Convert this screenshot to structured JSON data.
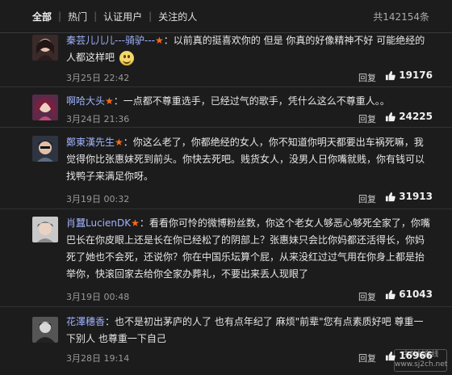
{
  "filters": {
    "tabs": [
      "全部",
      "热门",
      "认证用户",
      "关注的人"
    ],
    "total": "共142154条"
  },
  "comments": [
    {
      "user": "秦芸儿儿儿---骑驴---",
      "text": "：以前真的挺喜欢你的 但是 你真的好像精神不好  可能绝经的人都这样吧",
      "time": "3月25日 22:42",
      "reply": "回复",
      "likes": "19176"
    },
    {
      "user": "啊哈大头",
      "text": "：一点都不尊重选手，已经过气的歌手，凭什么这么不尊重人。。",
      "time": "3月24日 21:36",
      "reply": "回复",
      "likes": "24225"
    },
    {
      "user": "鄭東漢先生",
      "text": "：你这么老了，你都绝经的女人，你不知道你明天都要出车祸死嘛，我觉得你比张惠妹死到前头。你快去死吧。贱货女人，没男人日你嘴就贱，你有钱可以找鸭子来满足你呀。",
      "time": "3月19日 00:32",
      "reply": "回复",
      "likes": "31913"
    },
    {
      "user": "肖蠶LucienDK",
      "text": "：看看你可怜的微博粉丝数，你这个老女人够恶心够死全家了，你嘴巴长在你皮眼上还是长在你已经松了的阴部上？张惠妹只会比你妈都还活得长，你妈死了她也不会死，还说你？你在中国乐坛算个屁，从来没红过过气用在你身上都是抬举你，快滚回家去给你全家办葬礼，不要出来丢人现眼了",
      "time": "3月19日 00:48",
      "reply": "回复",
      "likes": "61043"
    },
    {
      "user": "花澤穗香",
      "text": "：也不是初出茅庐的人了 也有点年纪了 麻烦\"前辈\"您有点素质好吧 尊重一下别人 也尊重一下自己",
      "time": "3月28日 19:14",
      "reply": "回复",
      "likes": "16966"
    }
  ],
  "watermark": {
    "name": "中关村在线",
    "url": "www.sj2ch.net"
  }
}
